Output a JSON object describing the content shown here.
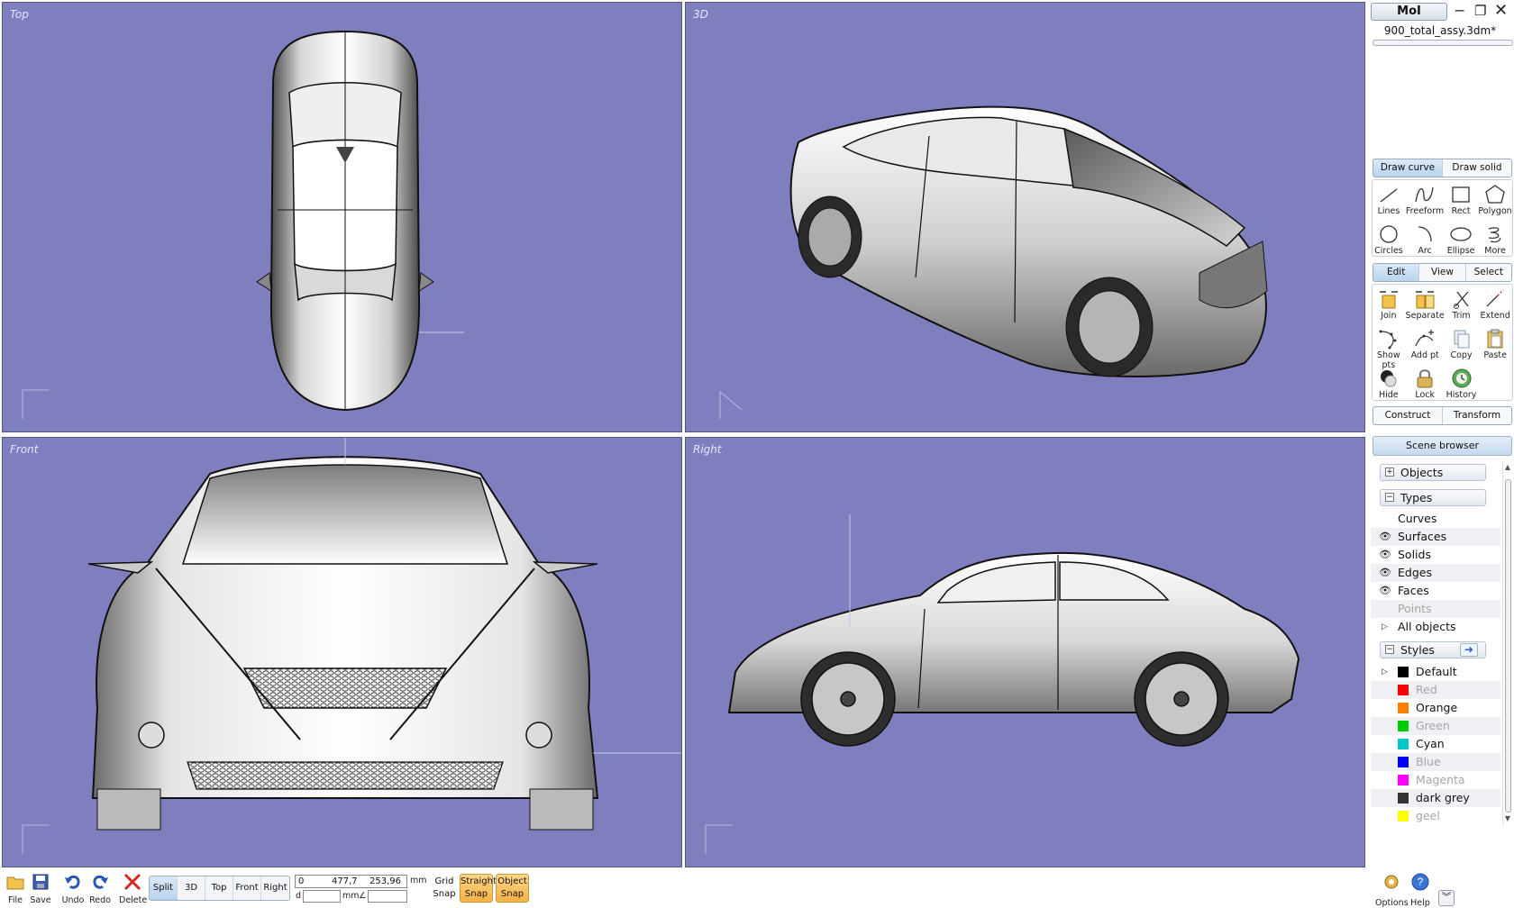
{
  "app": {
    "name": "MoI",
    "filename": "900_total_assy.3dm*"
  },
  "viewports": {
    "top": {
      "label": "Top"
    },
    "perspective": {
      "label": "3D"
    },
    "front": {
      "label": "Front"
    },
    "right": {
      "label": "Right"
    }
  },
  "draw_tabs": [
    "Draw curve",
    "Draw solid"
  ],
  "draw_tools": [
    {
      "label": "Lines",
      "icon": "lines-icon"
    },
    {
      "label": "Freeform",
      "icon": "freeform-icon"
    },
    {
      "label": "Rect",
      "icon": "rect-icon"
    },
    {
      "label": "Polygon",
      "icon": "polygon-icon"
    },
    {
      "label": "Circles",
      "icon": "circles-icon"
    },
    {
      "label": "Arc",
      "icon": "arc-icon"
    },
    {
      "label": "Ellipse",
      "icon": "ellipse-icon"
    },
    {
      "label": "More",
      "icon": "more-icon"
    }
  ],
  "edit_tabs": [
    "Edit",
    "View",
    "Select"
  ],
  "edit_tools": [
    {
      "label": "Join",
      "icon": "join-icon"
    },
    {
      "label": "Separate",
      "icon": "separate-icon"
    },
    {
      "label": "Trim",
      "icon": "trim-icon"
    },
    {
      "label": "Extend",
      "icon": "extend-icon"
    },
    {
      "label": "Show pts",
      "icon": "show-points-icon"
    },
    {
      "label": "Add pt",
      "icon": "add-point-icon"
    },
    {
      "label": "Copy",
      "icon": "copy-icon"
    },
    {
      "label": "Paste",
      "icon": "paste-icon"
    },
    {
      "label": "Hide",
      "icon": "hide-icon"
    },
    {
      "label": "Lock",
      "icon": "lock-icon"
    },
    {
      "label": "History",
      "icon": "history-icon"
    }
  ],
  "construct_tabs": [
    "Construct",
    "Transform"
  ],
  "scene_browser": {
    "title": "Scene browser",
    "objects_label": "Objects",
    "types_label": "Types",
    "types": [
      {
        "label": "Curves",
        "visible": false,
        "dim": false
      },
      {
        "label": "Surfaces",
        "visible": true,
        "dim": false
      },
      {
        "label": "Solids",
        "visible": true,
        "dim": false
      },
      {
        "label": "Edges",
        "visible": true,
        "dim": false
      },
      {
        "label": "Faces",
        "visible": true,
        "dim": false
      },
      {
        "label": "Points",
        "visible": false,
        "dim": true
      }
    ],
    "all_objects_label": "All objects",
    "styles_label": "Styles",
    "styles": [
      {
        "label": "Default",
        "color": "#000000",
        "dim": false
      },
      {
        "label": "Red",
        "color": "#ff0000",
        "dim": true
      },
      {
        "label": "Orange",
        "color": "#ff8000",
        "dim": false
      },
      {
        "label": "Green",
        "color": "#00cc00",
        "dim": true
      },
      {
        "label": "Cyan",
        "color": "#00c8c8",
        "dim": false
      },
      {
        "label": "Blue",
        "color": "#0000ff",
        "dim": true
      },
      {
        "label": "Magenta",
        "color": "#ff00ff",
        "dim": true
      },
      {
        "label": "dark grey",
        "color": "#333333",
        "dim": false
      },
      {
        "label": "geel",
        "color": "#ffff00",
        "dim": true
      }
    ]
  },
  "bottom": {
    "file": "File",
    "save": "Save",
    "undo": "Undo",
    "redo": "Redo",
    "delete": "Delete",
    "view_tabs": [
      "Split",
      "3D",
      "Top",
      "Front",
      "Right"
    ],
    "coord_x": "0",
    "coord_y": "477,7",
    "coord_z": "253,96",
    "unit": "mm",
    "d_label": "d",
    "d_unit": "mm",
    "angle_symbol": "∠",
    "grid_snap": [
      "Grid",
      "Snap"
    ],
    "straight_snap": [
      "Straight",
      "Snap"
    ],
    "object_snap": [
      "Object",
      "Snap"
    ],
    "options": "Options",
    "help": "Help"
  },
  "colors": {
    "viewport_bg": "#7f7fc0",
    "active_tab": "#b9d3ee",
    "snap_active": "#f6b243"
  }
}
